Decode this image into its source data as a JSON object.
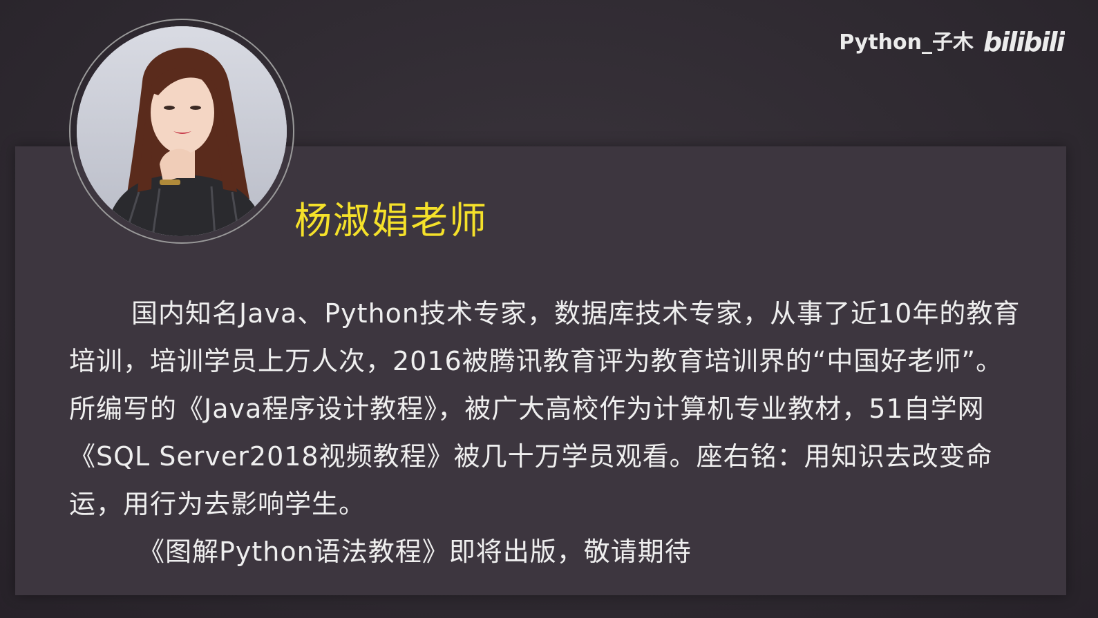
{
  "watermark": {
    "channel": "Python_子木",
    "logo_text": "bilibili"
  },
  "profile": {
    "name": "杨淑娟老师",
    "photo_icon": "teacher-portrait",
    "bio": "国内知名Java、Python技术专家，数据库技术专家，从事了近10年的教育培训，培训学员上万人次，2016被腾讯教育评为教育培训界的“中国好老师”。所编写的《Java程序设计教程》，被广大高校作为计算机专业教材，51自学网《SQL Server2018视频教程》被几十万学员观看。座右铭：用知识去改变命运，用行为去影响学生。",
    "note": "《图解Python语法教程》即将出版，敬请期待"
  },
  "colors": {
    "background": "#2f2a31",
    "panel": "#3d363f",
    "name": "#f5e12a",
    "text": "#efefef"
  }
}
